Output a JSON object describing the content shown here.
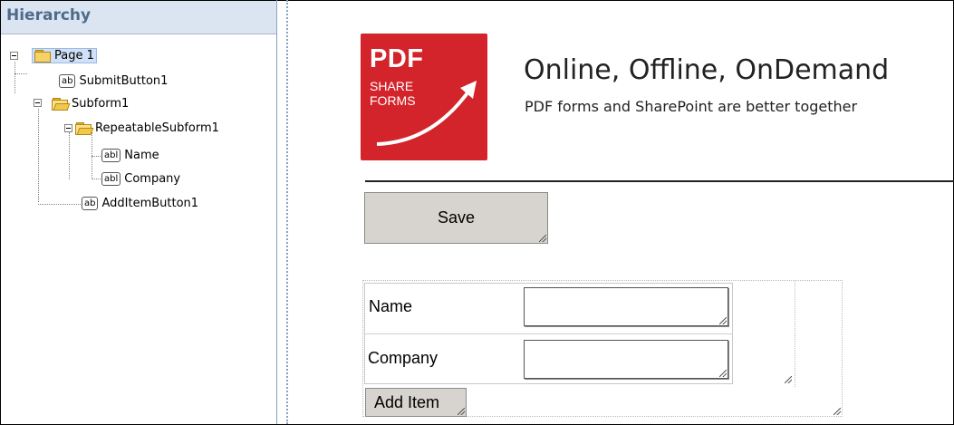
{
  "hierarchy": {
    "title": "Hierarchy",
    "nodes": {
      "page": "Page 1",
      "submit": "SubmitButton1",
      "subform": "Subform1",
      "repeatable": "RepeatableSubform1",
      "name": "Name",
      "company": "Company",
      "additem": "AddItemButton1"
    },
    "icons": {
      "button": "ab",
      "textfield": "abl"
    }
  },
  "form": {
    "logo": {
      "line1": "PDF",
      "line2": "SHARE",
      "line3": "FORMS"
    },
    "heading": "Online, Offline, OnDemand",
    "subheading": "PDF forms and SharePoint are better together",
    "save_label": "Save",
    "fields": {
      "name_label": "Name",
      "company_label": "Company"
    },
    "add_item_label": "Add Item"
  },
  "colors": {
    "logo_red": "#d4242b",
    "button_gray": "#d7d4cf",
    "panel_header": "#dbe5f1"
  }
}
